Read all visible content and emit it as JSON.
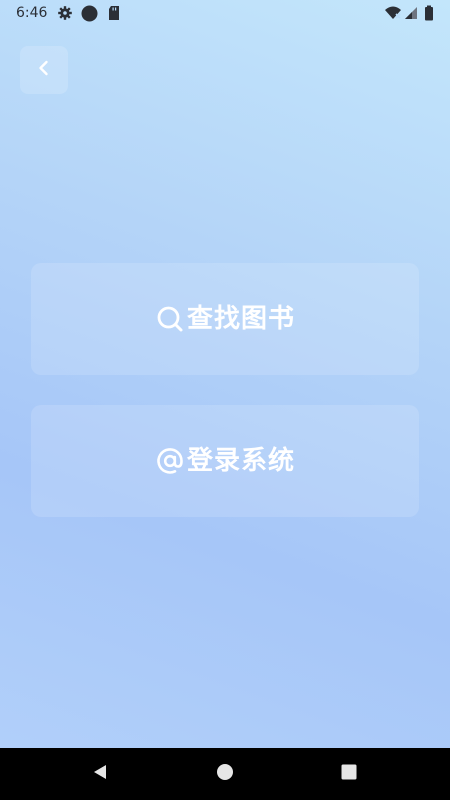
{
  "status_bar": {
    "time": "6:46",
    "left_icons": [
      "gear-icon",
      "circle-icon",
      "sd-card-icon"
    ],
    "right_icons": [
      "wifi-icon",
      "signal-icon",
      "battery-icon"
    ]
  },
  "header": {
    "back_icon": "chevron-left-icon"
  },
  "menu": {
    "search": {
      "icon": "search-icon",
      "label": "查找图书"
    },
    "login": {
      "icon": "at-icon",
      "label": "登录系统"
    }
  },
  "nav_bar": {
    "buttons": [
      "back-triangle-icon",
      "home-circle-icon",
      "recents-square-icon"
    ]
  },
  "colors": {
    "background_start": "#c3e6fb",
    "background_end": "#a6c6f8",
    "text": "#ffffff",
    "nav_bar": "#000000"
  }
}
